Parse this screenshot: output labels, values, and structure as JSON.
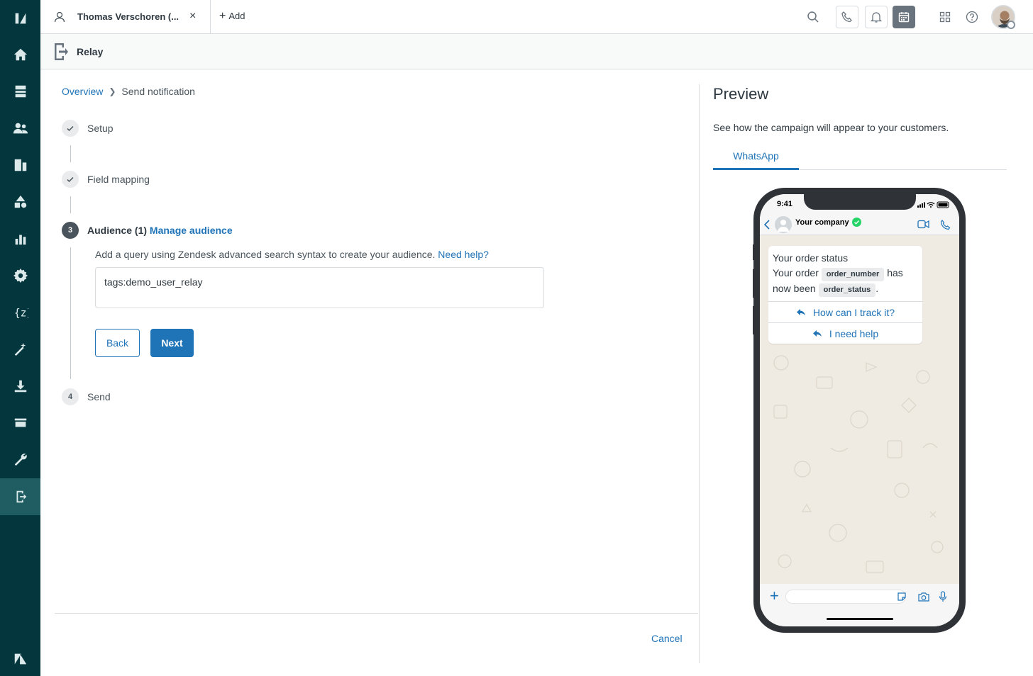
{
  "tab": {
    "label": "Thomas Verschoren (...",
    "close": "×"
  },
  "topbar": {
    "add_label": "Add"
  },
  "subheader": {
    "title": "Relay"
  },
  "breadcrumb": {
    "parent": "Overview",
    "current": "Send notification"
  },
  "steps": {
    "s1": "Setup",
    "s2": "Field mapping",
    "s3_number": "3",
    "s3_label": "Audience (1)",
    "s3_link": "Manage audience",
    "s4_number": "4",
    "s4_label": "Send"
  },
  "audience": {
    "hint": "Add a query using Zendesk advanced search syntax to create your audience.",
    "help_link": "Need help?",
    "query_value": "tags:demo_user_relay"
  },
  "buttons": {
    "back": "Back",
    "next": "Next",
    "cancel": "Cancel"
  },
  "preview": {
    "title": "Preview",
    "description": "See how the campaign will appear to your customers.",
    "tab": "WhatsApp",
    "phone_time": "9:41",
    "company": "Your company",
    "msg_title": "Your order status",
    "msg_pre": "Your order",
    "chip1": "order_number",
    "msg_mid1": "has",
    "msg_mid2": "now been",
    "chip2": "order_status",
    "msg_end": ".",
    "reply1": "How can I track it?",
    "reply2": "I need help"
  },
  "colors": {
    "sidebar": "#03363d",
    "accent": "#1f73b7",
    "whatsapp_verified": "#25d366"
  }
}
